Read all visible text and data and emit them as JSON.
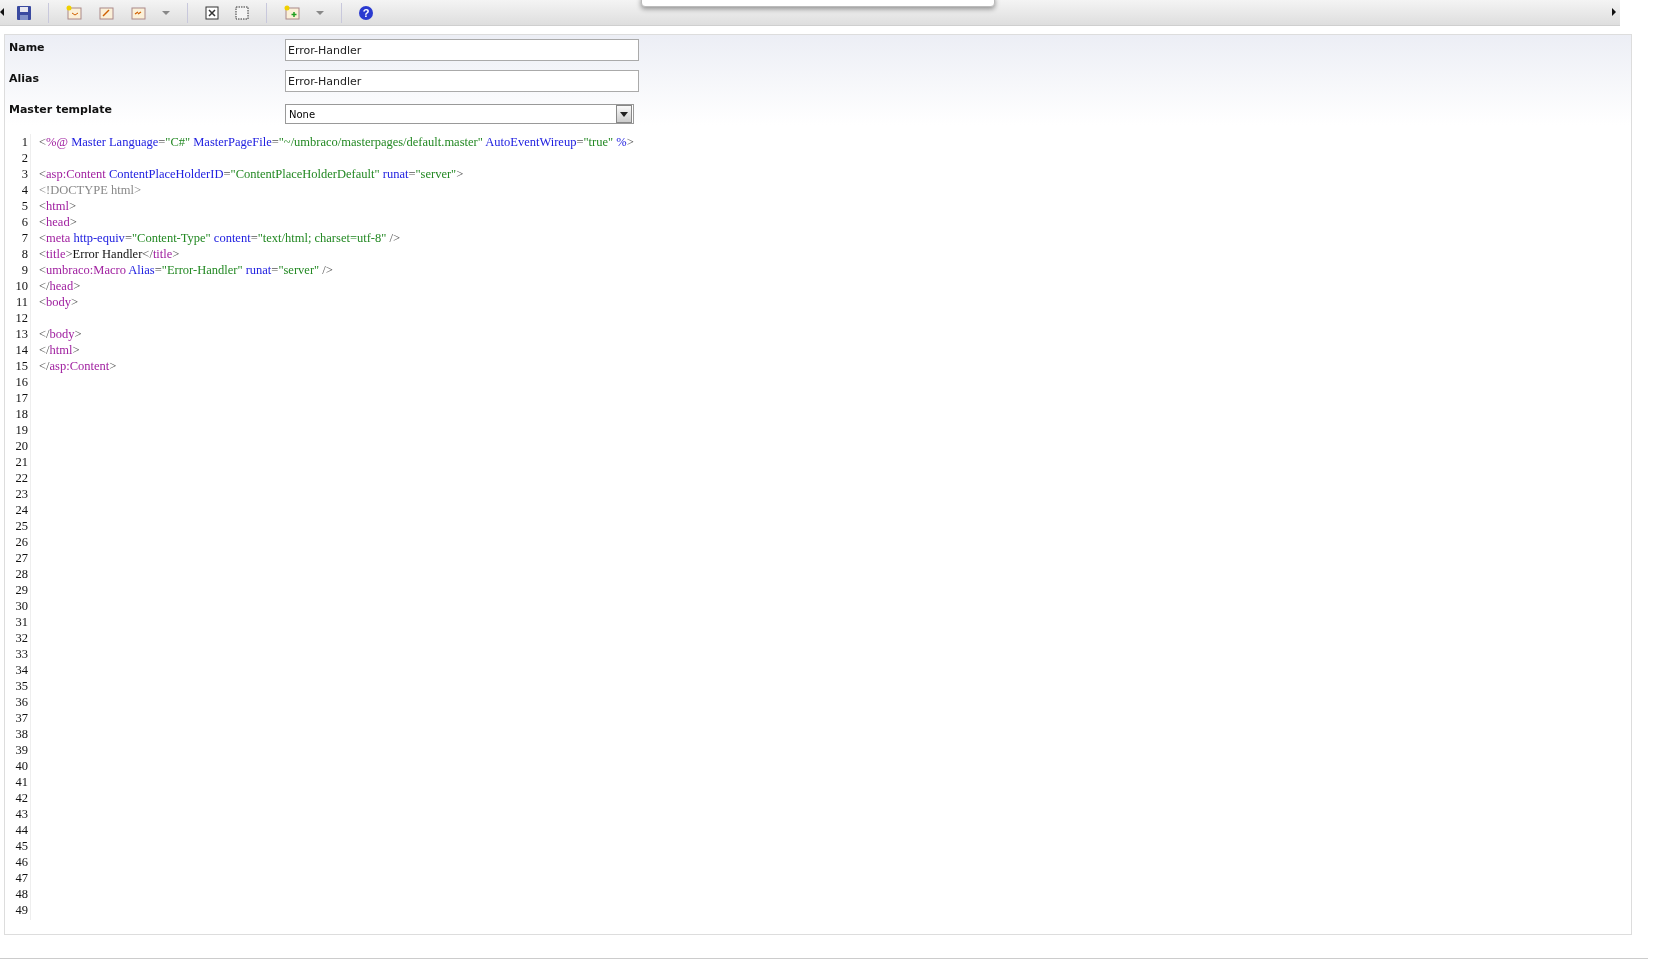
{
  "toolbar": {
    "buttons": [
      {
        "kind": "save"
      },
      {
        "kind": "new-doc"
      },
      {
        "kind": "doc-edit"
      },
      {
        "kind": "doc-arrows"
      },
      {
        "kind": "dropdown"
      },
      {
        "kind": "box-x"
      },
      {
        "kind": "box-dashed"
      },
      {
        "kind": "new-doc-plus"
      },
      {
        "kind": "dropdown"
      },
      {
        "kind": "help",
        "glyph": "?"
      }
    ]
  },
  "form": [
    {
      "label": "Name",
      "kind": "text",
      "value": "Error-Handler"
    },
    {
      "label": "Alias",
      "kind": "text",
      "value": "Error-Handler"
    },
    {
      "label": "Master template",
      "kind": "select",
      "value": "None"
    }
  ],
  "code_lines": [
    {
      "number": "1",
      "tokens": [
        {
          "kind": "punct",
          "text": "<"
        },
        {
          "kind": "tag",
          "text": "%@"
        },
        {
          "kind": "attr",
          "text": " Master Language"
        },
        {
          "kind": "punct",
          "text": "="
        },
        {
          "kind": "string",
          "text": "\"C#\""
        },
        {
          "kind": "attr",
          "text": " MasterPageFile"
        },
        {
          "kind": "punct",
          "text": "="
        },
        {
          "kind": "string",
          "text": "\"~/umbraco/masterpages/default.master\""
        },
        {
          "kind": "attr",
          "text": " AutoEventWireup"
        },
        {
          "kind": "punct",
          "text": "="
        },
        {
          "kind": "string",
          "text": "\"true\""
        },
        {
          "kind": "attr",
          "text": " %"
        },
        {
          "kind": "punct",
          "text": ">"
        }
      ]
    },
    {
      "number": "2"
    },
    {
      "number": "3",
      "tokens": [
        {
          "kind": "punct",
          "text": "<"
        },
        {
          "kind": "tag",
          "text": "asp:Content"
        },
        {
          "kind": "attr",
          "text": " ContentPlaceHolderID"
        },
        {
          "kind": "punct",
          "text": "="
        },
        {
          "kind": "string",
          "text": "\"ContentPlaceHolderDefault\""
        },
        {
          "kind": "attr",
          "text": " runat"
        },
        {
          "kind": "punct",
          "text": "="
        },
        {
          "kind": "string",
          "text": "\"server\""
        },
        {
          "kind": "punct",
          "text": ">"
        }
      ]
    },
    {
      "number": "4",
      "tokens": [
        {
          "kind": "doctype",
          "text": "<!DOCTYPE html>"
        }
      ]
    },
    {
      "number": "5",
      "tokens": [
        {
          "kind": "punct",
          "text": "<"
        },
        {
          "kind": "tag",
          "text": "html"
        },
        {
          "kind": "punct",
          "text": ">"
        }
      ]
    },
    {
      "number": "6",
      "tokens": [
        {
          "kind": "punct",
          "text": "<"
        },
        {
          "kind": "tag",
          "text": "head"
        },
        {
          "kind": "punct",
          "text": ">"
        }
      ]
    },
    {
      "number": "7",
      "tokens": [
        {
          "kind": "punct",
          "text": "<"
        },
        {
          "kind": "tag",
          "text": "meta"
        },
        {
          "kind": "attr",
          "text": " http-equiv"
        },
        {
          "kind": "punct",
          "text": "="
        },
        {
          "kind": "string",
          "text": "\"Content-Type\""
        },
        {
          "kind": "attr",
          "text": " content"
        },
        {
          "kind": "punct",
          "text": "="
        },
        {
          "kind": "string",
          "text": "\"text/html; charset=utf-8\""
        },
        {
          "kind": "punct",
          "text": " />"
        }
      ]
    },
    {
      "number": "8",
      "tokens": [
        {
          "kind": "punct",
          "text": "<"
        },
        {
          "kind": "tag",
          "text": "title"
        },
        {
          "kind": "punct",
          "text": ">"
        },
        {
          "kind": "text",
          "text": "Error Handler"
        },
        {
          "kind": "punct",
          "text": "</"
        },
        {
          "kind": "tag",
          "text": "title"
        },
        {
          "kind": "punct",
          "text": ">"
        }
      ]
    },
    {
      "number": "9",
      "tokens": [
        {
          "kind": "punct",
          "text": "<"
        },
        {
          "kind": "tag",
          "text": "umbraco:Macro"
        },
        {
          "kind": "attr",
          "text": " Alias"
        },
        {
          "kind": "punct",
          "text": "="
        },
        {
          "kind": "string",
          "text": "\"Error-Handler\""
        },
        {
          "kind": "attr",
          "text": " runat"
        },
        {
          "kind": "punct",
          "text": "="
        },
        {
          "kind": "string",
          "text": "\"server\""
        },
        {
          "kind": "punct",
          "text": " />"
        }
      ]
    },
    {
      "number": "10",
      "tokens": [
        {
          "kind": "punct",
          "text": "</"
        },
        {
          "kind": "tag",
          "text": "head"
        },
        {
          "kind": "punct",
          "text": ">"
        }
      ]
    },
    {
      "number": "11",
      "tokens": [
        {
          "kind": "punct",
          "text": "<"
        },
        {
          "kind": "tag",
          "text": "body"
        },
        {
          "kind": "punct",
          "text": ">"
        }
      ]
    },
    {
      "number": "12"
    },
    {
      "number": "13",
      "tokens": [
        {
          "kind": "punct",
          "text": "</"
        },
        {
          "kind": "tag",
          "text": "body"
        },
        {
          "kind": "punct",
          "text": ">"
        }
      ]
    },
    {
      "number": "14",
      "tokens": [
        {
          "kind": "punct",
          "text": "</"
        },
        {
          "kind": "tag",
          "text": "html"
        },
        {
          "kind": "punct",
          "text": ">"
        }
      ]
    },
    {
      "number": "15",
      "tokens": [
        {
          "kind": "punct",
          "text": "</"
        },
        {
          "kind": "tag",
          "text": "asp:Content"
        },
        {
          "kind": "punct",
          "text": ">"
        }
      ]
    },
    {
      "number": "16"
    },
    {
      "number": "17"
    },
    {
      "number": "18"
    },
    {
      "number": "19"
    },
    {
      "number": "20"
    },
    {
      "number": "21"
    },
    {
      "number": "22"
    },
    {
      "number": "23"
    },
    {
      "number": "24"
    },
    {
      "number": "25"
    },
    {
      "number": "26"
    },
    {
      "number": "27"
    },
    {
      "number": "28"
    },
    {
      "number": "29"
    },
    {
      "number": "30"
    },
    {
      "number": "31"
    },
    {
      "number": "32"
    },
    {
      "number": "33"
    },
    {
      "number": "34"
    },
    {
      "number": "35"
    },
    {
      "number": "36"
    },
    {
      "number": "37"
    },
    {
      "number": "38"
    },
    {
      "number": "39"
    },
    {
      "number": "40"
    },
    {
      "number": "41"
    },
    {
      "number": "42"
    },
    {
      "number": "43"
    },
    {
      "number": "44"
    },
    {
      "number": "45"
    },
    {
      "number": "46"
    },
    {
      "number": "47"
    },
    {
      "number": "48"
    },
    {
      "number": "49"
    }
  ]
}
